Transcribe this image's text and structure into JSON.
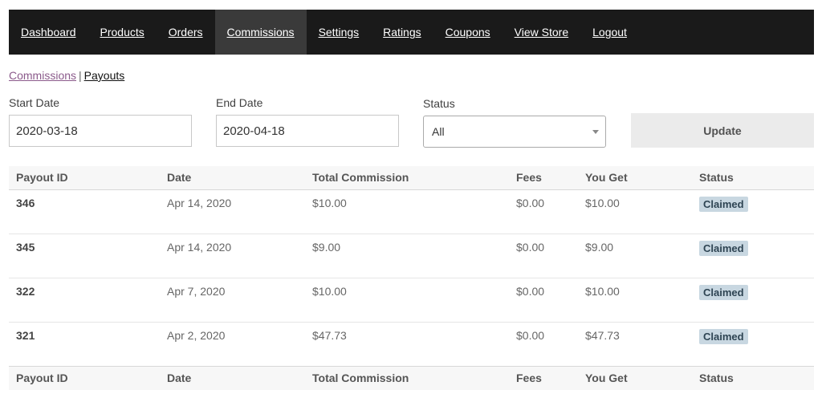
{
  "nav": {
    "items": [
      {
        "label": "Dashboard"
      },
      {
        "label": "Products"
      },
      {
        "label": "Orders"
      },
      {
        "label": "Commissions"
      },
      {
        "label": "Settings"
      },
      {
        "label": "Ratings"
      },
      {
        "label": "Coupons"
      },
      {
        "label": "View Store"
      },
      {
        "label": "Logout"
      }
    ],
    "active": "Commissions"
  },
  "subnav": {
    "commissions_label": "Commissions",
    "separator": "|",
    "payouts_label": "Payouts"
  },
  "filters": {
    "start_date_label": "Start Date",
    "start_date_value": "2020-03-18",
    "end_date_label": "End Date",
    "end_date_value": "2020-04-18",
    "status_label": "Status",
    "status_value": "All",
    "update_label": "Update"
  },
  "table": {
    "headers": [
      "Payout ID",
      "Date",
      "Total Commission",
      "Fees",
      "You Get",
      "Status"
    ],
    "rows": [
      {
        "id": "346",
        "date": "Apr 14, 2020",
        "total": "$10.00",
        "fees": "$0.00",
        "you_get": "$10.00",
        "status": "Claimed"
      },
      {
        "id": "345",
        "date": "Apr 14, 2020",
        "total": "$9.00",
        "fees": "$0.00",
        "you_get": "$9.00",
        "status": "Claimed"
      },
      {
        "id": "322",
        "date": "Apr 7, 2020",
        "total": "$10.00",
        "fees": "$0.00",
        "you_get": "$10.00",
        "status": "Claimed"
      },
      {
        "id": "321",
        "date": "Apr 2, 2020",
        "total": "$47.73",
        "fees": "$0.00",
        "you_get": "$47.73",
        "status": "Claimed"
      }
    ]
  },
  "colors": {
    "nav_background": "#1a1a1a",
    "nav_active_background": "#3a3a3a",
    "badge_background": "#c8d7e1",
    "visited_link": "#8b5a8b"
  }
}
